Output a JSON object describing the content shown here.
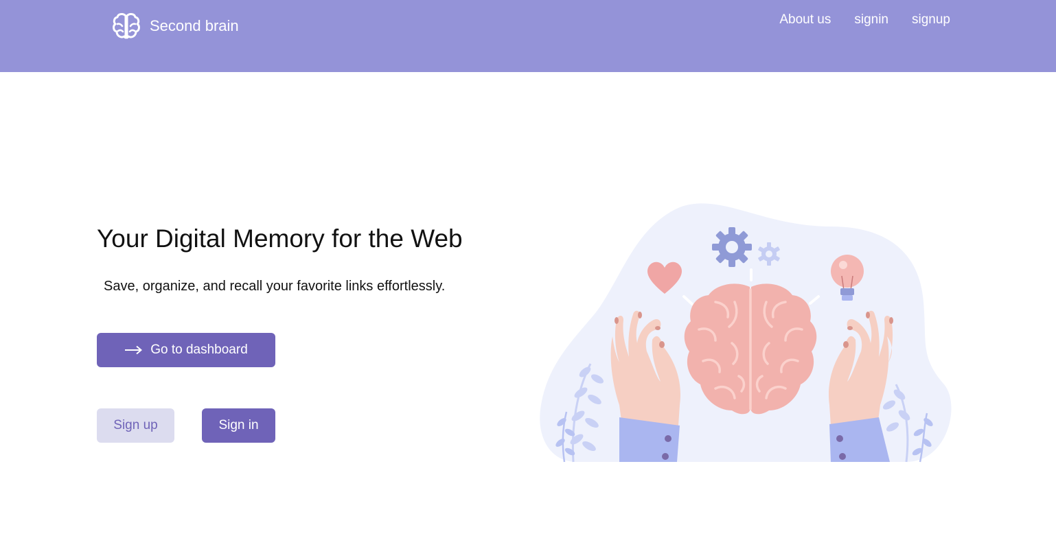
{
  "brand": {
    "name": "Second brain",
    "icon": "brain-icon"
  },
  "nav": {
    "links": [
      {
        "label": "About us"
      },
      {
        "label": "signin"
      },
      {
        "label": "signup"
      }
    ]
  },
  "hero": {
    "title": "Your Digital Memory for the Web",
    "subtitle": "Save, organize, and recall your favorite links effortlessly.",
    "dashboard_button": {
      "label": "Go to dashboard",
      "icon": "arrow-right-icon"
    },
    "signup_button": {
      "label": "Sign up"
    },
    "signin_button": {
      "label": "Sign in"
    }
  },
  "illustration": {
    "elements": [
      "brain",
      "hands",
      "heart-icon",
      "gear-icon",
      "lightbulb-icon",
      "leaves"
    ]
  },
  "colors": {
    "navbar": "#9493d8",
    "primary": "#6f63b8",
    "secondary_bg": "#dcdcef",
    "blob": "#eef1fc",
    "brain": "#f2b2ad",
    "skin": "#f6cfc3",
    "sleeve": "#aab6f0"
  }
}
